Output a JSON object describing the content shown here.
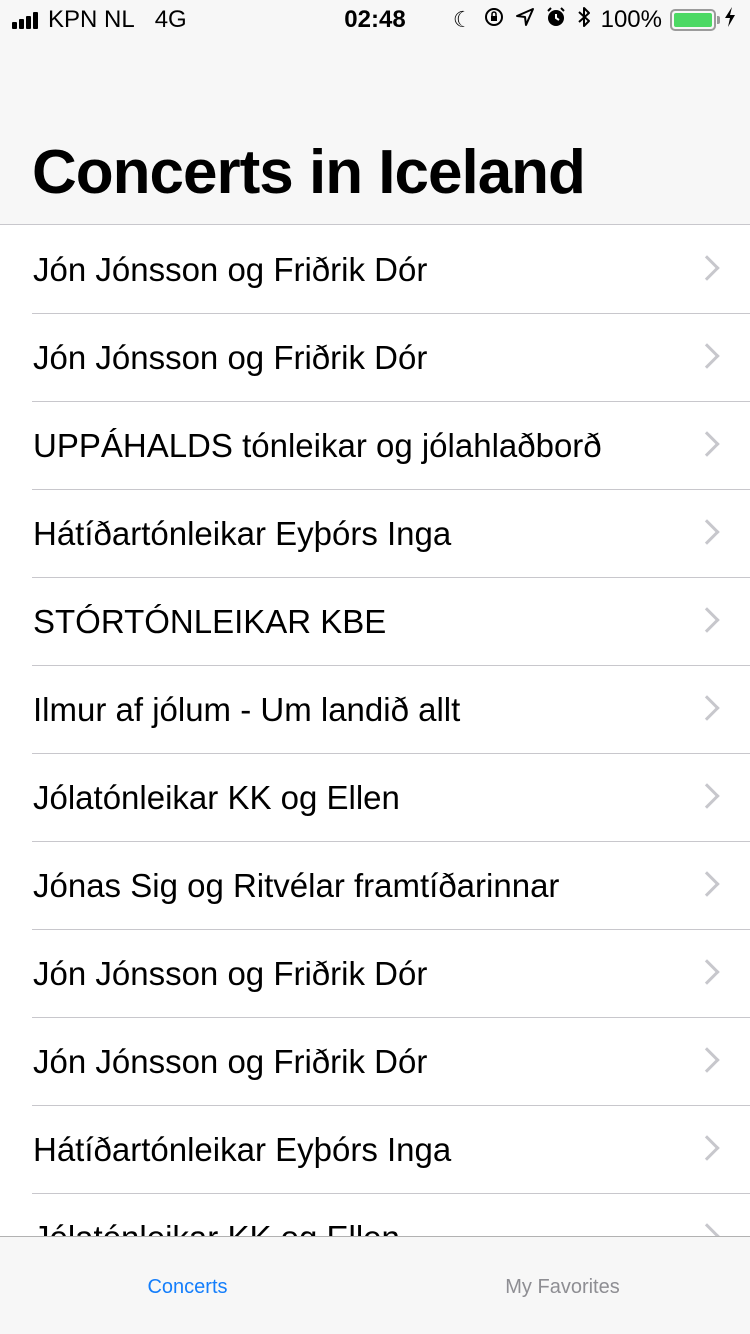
{
  "status_bar": {
    "carrier": "KPN NL",
    "network": "4G",
    "time": "02:48",
    "battery_percent": "100%",
    "battery_level": 1.0,
    "icons": [
      "moon-icon",
      "orientation-lock-icon",
      "location-icon",
      "alarm-icon",
      "bluetooth-icon",
      "charging-bolt-icon"
    ]
  },
  "header": {
    "title": "Concerts in Iceland"
  },
  "concerts": [
    "Jón Jónsson og Friðrik Dór",
    "Jón Jónsson og Friðrik Dór",
    "UPPÁHALDS tónleikar og jólahlaðborð",
    "Hátíðartónleikar Eyþórs Inga",
    "STÓRTÓNLEIKAR KBE",
    "Ilmur af jólum - Um landið allt",
    "Jólatónleikar KK og Ellen",
    "Jónas Sig og Ritvélar framtíðarinnar",
    "Jón Jónsson og Friðrik Dór",
    "Jón Jónsson og Friðrik Dór",
    "Hátíðartónleikar Eyþórs Inga",
    "Jólatónleikar KK og Ellen"
  ],
  "tab_bar": {
    "tabs": [
      {
        "label": "Concerts",
        "active": true
      },
      {
        "label": "My Favorites",
        "active": false
      }
    ]
  },
  "colors": {
    "accent": "#147efb",
    "inactive": "#8e8e93",
    "separator": "#c8c7cc",
    "battery": "#4cd964"
  }
}
